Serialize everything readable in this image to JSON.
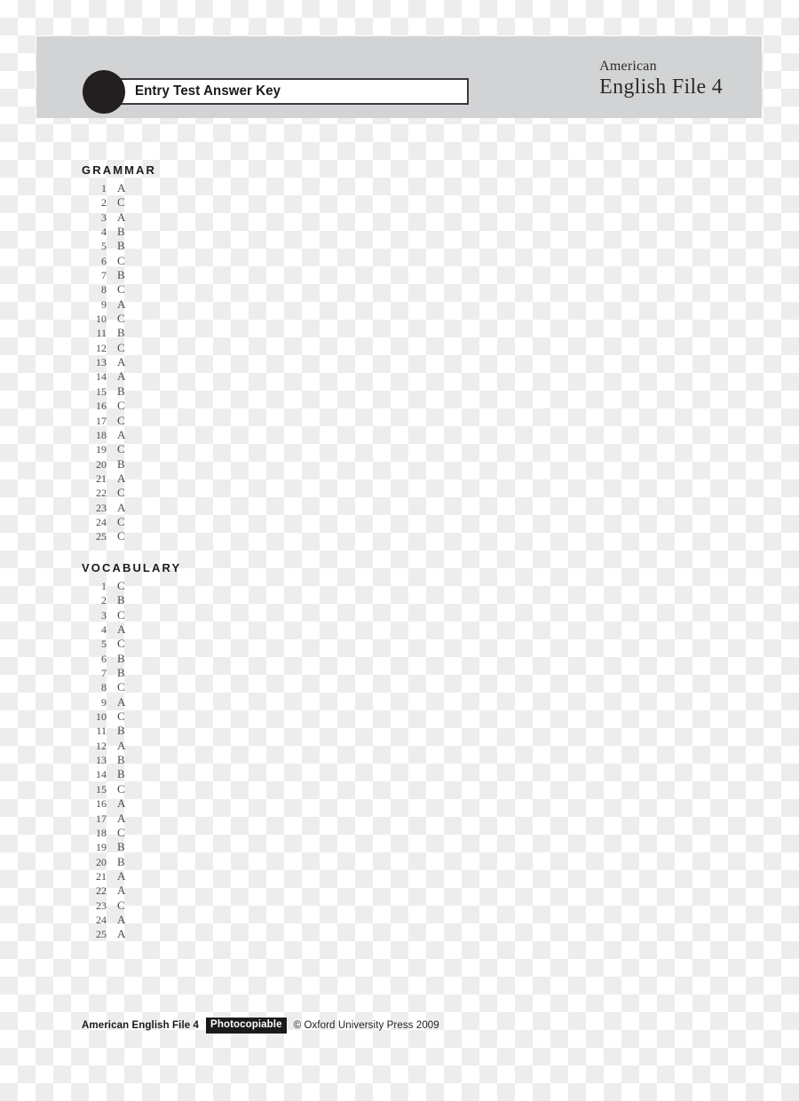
{
  "header": {
    "title": "Entry Test Answer Key",
    "bullet_icon": "filled-circle-icon",
    "brand_line1": "American",
    "brand_line2": "English File 4",
    "band_color": "#d2d3d4"
  },
  "sections": [
    {
      "id": "grammar",
      "title": "GRAMMAR",
      "answers": [
        {
          "number": "1",
          "letter": "A"
        },
        {
          "number": "2",
          "letter": "C"
        },
        {
          "number": "3",
          "letter": "A"
        },
        {
          "number": "4",
          "letter": "B"
        },
        {
          "number": "5",
          "letter": "B"
        },
        {
          "number": "6",
          "letter": "C"
        },
        {
          "number": "7",
          "letter": "B"
        },
        {
          "number": "8",
          "letter": "C"
        },
        {
          "number": "9",
          "letter": "A"
        },
        {
          "number": "10",
          "letter": "C"
        },
        {
          "number": "11",
          "letter": "B"
        },
        {
          "number": "12",
          "letter": "C"
        },
        {
          "number": "13",
          "letter": "A"
        },
        {
          "number": "14",
          "letter": "A"
        },
        {
          "number": "15",
          "letter": "B"
        },
        {
          "number": "16",
          "letter": "C"
        },
        {
          "number": "17",
          "letter": "C"
        },
        {
          "number": "18",
          "letter": "A"
        },
        {
          "number": "19",
          "letter": "C"
        },
        {
          "number": "20",
          "letter": "B"
        },
        {
          "number": "21",
          "letter": "A"
        },
        {
          "number": "22",
          "letter": "C"
        },
        {
          "number": "23",
          "letter": "A"
        },
        {
          "number": "24",
          "letter": "C"
        },
        {
          "number": "25",
          "letter": "C"
        }
      ]
    },
    {
      "id": "vocabulary",
      "title": "VOCABULARY",
      "answers": [
        {
          "number": "1",
          "letter": "C"
        },
        {
          "number": "2",
          "letter": "B"
        },
        {
          "number": "3",
          "letter": "C"
        },
        {
          "number": "4",
          "letter": "A"
        },
        {
          "number": "5",
          "letter": "C"
        },
        {
          "number": "6",
          "letter": "B"
        },
        {
          "number": "7",
          "letter": "B"
        },
        {
          "number": "8",
          "letter": "C"
        },
        {
          "number": "9",
          "letter": "A"
        },
        {
          "number": "10",
          "letter": "C"
        },
        {
          "number": "11",
          "letter": "B"
        },
        {
          "number": "12",
          "letter": "A"
        },
        {
          "number": "13",
          "letter": "B"
        },
        {
          "number": "14",
          "letter": "B"
        },
        {
          "number": "15",
          "letter": "C"
        },
        {
          "number": "16",
          "letter": "A"
        },
        {
          "number": "17",
          "letter": "A"
        },
        {
          "number": "18",
          "letter": "C"
        },
        {
          "number": "19",
          "letter": "B"
        },
        {
          "number": "20",
          "letter": "B"
        },
        {
          "number": "21",
          "letter": "A"
        },
        {
          "number": "22",
          "letter": "A"
        },
        {
          "number": "23",
          "letter": "C"
        },
        {
          "number": "24",
          "letter": "A"
        },
        {
          "number": "25",
          "letter": "A"
        }
      ]
    }
  ],
  "footer": {
    "book": "American English File 4",
    "badge": "Photocopiable",
    "copyright": "© Oxford University Press 2009"
  }
}
